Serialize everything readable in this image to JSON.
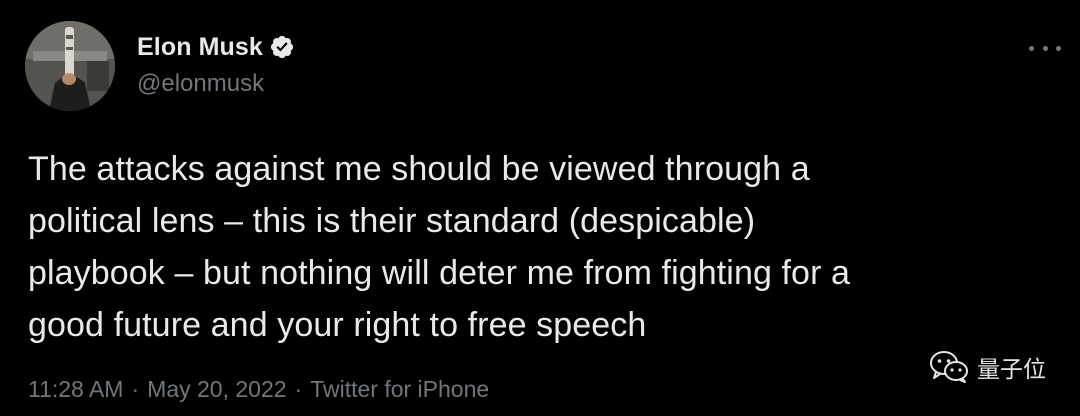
{
  "author": {
    "display_name": "Elon Musk",
    "handle": "@elonmusk",
    "verified": true,
    "avatar_icon": "profile-photo"
  },
  "tweet": {
    "text_lines": [
      "The attacks against me should be viewed through a",
      "political lens – this is their standard (despicable)",
      "playbook – but nothing will deter me from fighting for a",
      "good future and your right to free speech"
    ],
    "time": "11:28 AM",
    "separator": "·",
    "date": "May 20, 2022",
    "source": "Twitter for iPhone"
  },
  "more_icon": "more-options-icon",
  "watermark": {
    "text": "量子位",
    "icon": "wechat-icon"
  },
  "colors": {
    "background": "#000000",
    "text": "#e7e9ea",
    "secondary": "#71767b",
    "verified": "#1d9bf0"
  }
}
